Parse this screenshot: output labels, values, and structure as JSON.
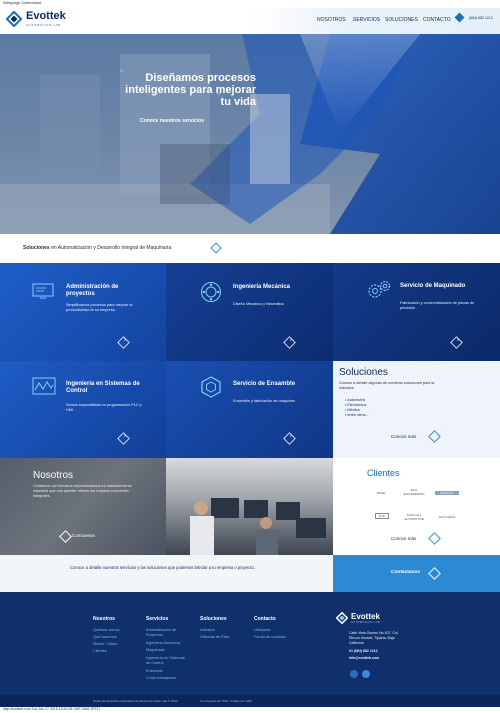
{
  "browser_caption": "Webpage Screenshot",
  "footer_caption": "http://evottek.com Tue Jan 27 2015 13:50:38 GMT-0800 (PST)",
  "brand": {
    "name": "Evottek",
    "tagline": "AUTOMATION LAB",
    "accent": "#1c6fb5",
    "dark": "#0d2a5b"
  },
  "nav": {
    "items": [
      "NOSOTROS",
      "SERVICIOS",
      "SOLUCIONES",
      "CONTACTO"
    ],
    "phone": "(664) 682 1212"
  },
  "hero": {
    "title": "Diseñamos procesos inteligentes para mejorar tu vida",
    "cta": "Conoce nuestros servicios"
  },
  "intro": {
    "lead": "Soluciones",
    "rest": " en Automatización y Desarrollo Integral de Maquinaria"
  },
  "services": [
    {
      "title": "Administración de proyectos",
      "desc": "Simplificamos procesos para mejorar la productividad de su empresa",
      "icon": "monitor-icon"
    },
    {
      "title": "Ingeniería Mecánica",
      "desc": "Diseño Mecánico y Neumático",
      "icon": "bearing-icon"
    },
    {
      "title": "Servicio de Maquinado",
      "desc": "Fabricación y comercialización de piezas de precisión",
      "icon": "gears-icon"
    },
    {
      "title": "Ingeniería en Sistemas de Control",
      "desc": "Somos especialistas en programación PLC y HMI",
      "icon": "wave-icon"
    },
    {
      "title": "Servicio de Ensamble",
      "desc": "Ensamble y fabricación de maquinas",
      "icon": "hexagon-icon"
    }
  ],
  "soluciones": {
    "title": "Soluciones",
    "desc": "Conoce a detalle algunas de nuestras soluciones para la industria:",
    "items": [
      "Automotriz",
      "Electrónica",
      "Médica",
      "entre otros..."
    ],
    "more": "Conoce más"
  },
  "nosotros": {
    "title": "Nosotros",
    "desc": "Contamos con técnicos experimentados en mantenimiento industrial que nos permite ofrecer las mejores soluciones integrales.",
    "cta": "Conócenos"
  },
  "clientes": {
    "title": "Clientes",
    "logos": [
      "BOSE",
      "ECO ENGINEERING",
      "Medtronic",
      "ETP",
      "Flextronics AUTOMOTIVE",
      "RAYTHEON"
    ],
    "more": "Conoce más"
  },
  "contact": {
    "text": "Conoce a detalle nuestros servicios y las soluciones que podemos brindar a tu empresa o proyecto.",
    "button": "Contáctanos"
  },
  "footer": {
    "nosotros": {
      "title": "Nosotros",
      "links": [
        "Quiénes somos",
        "Qué hacemos",
        "Misión / Visión",
        "Clientes"
      ]
    },
    "servicios": {
      "title": "Servicios",
      "links": [
        "Administración de Proyectos",
        "Ingeniería Mecánica",
        "Maquinado",
        "Ingeniería en Sistemas de Control",
        "Ensamble",
        "Como trabajamos"
      ]
    },
    "soluciones": {
      "title": "Soluciones",
      "links": [
        "Industria",
        "Historias de Éxito"
      ]
    },
    "contacto": {
      "title": "Contacto",
      "links": [
        "Ubicación",
        "Forma de contacto"
      ]
    },
    "address": [
      "Calle Vista Osorno No 107, Col.",
      "Rincon Dorado, Tijuana, Baja",
      "California"
    ],
    "phone": "01 (664) 682 1212",
    "email": "info@evottek.com",
    "copyright": "Todos los derechos reservados Evottek Automation Lab © 2014",
    "credit": "Un proyecto de: PKG. Código por: RKit"
  }
}
